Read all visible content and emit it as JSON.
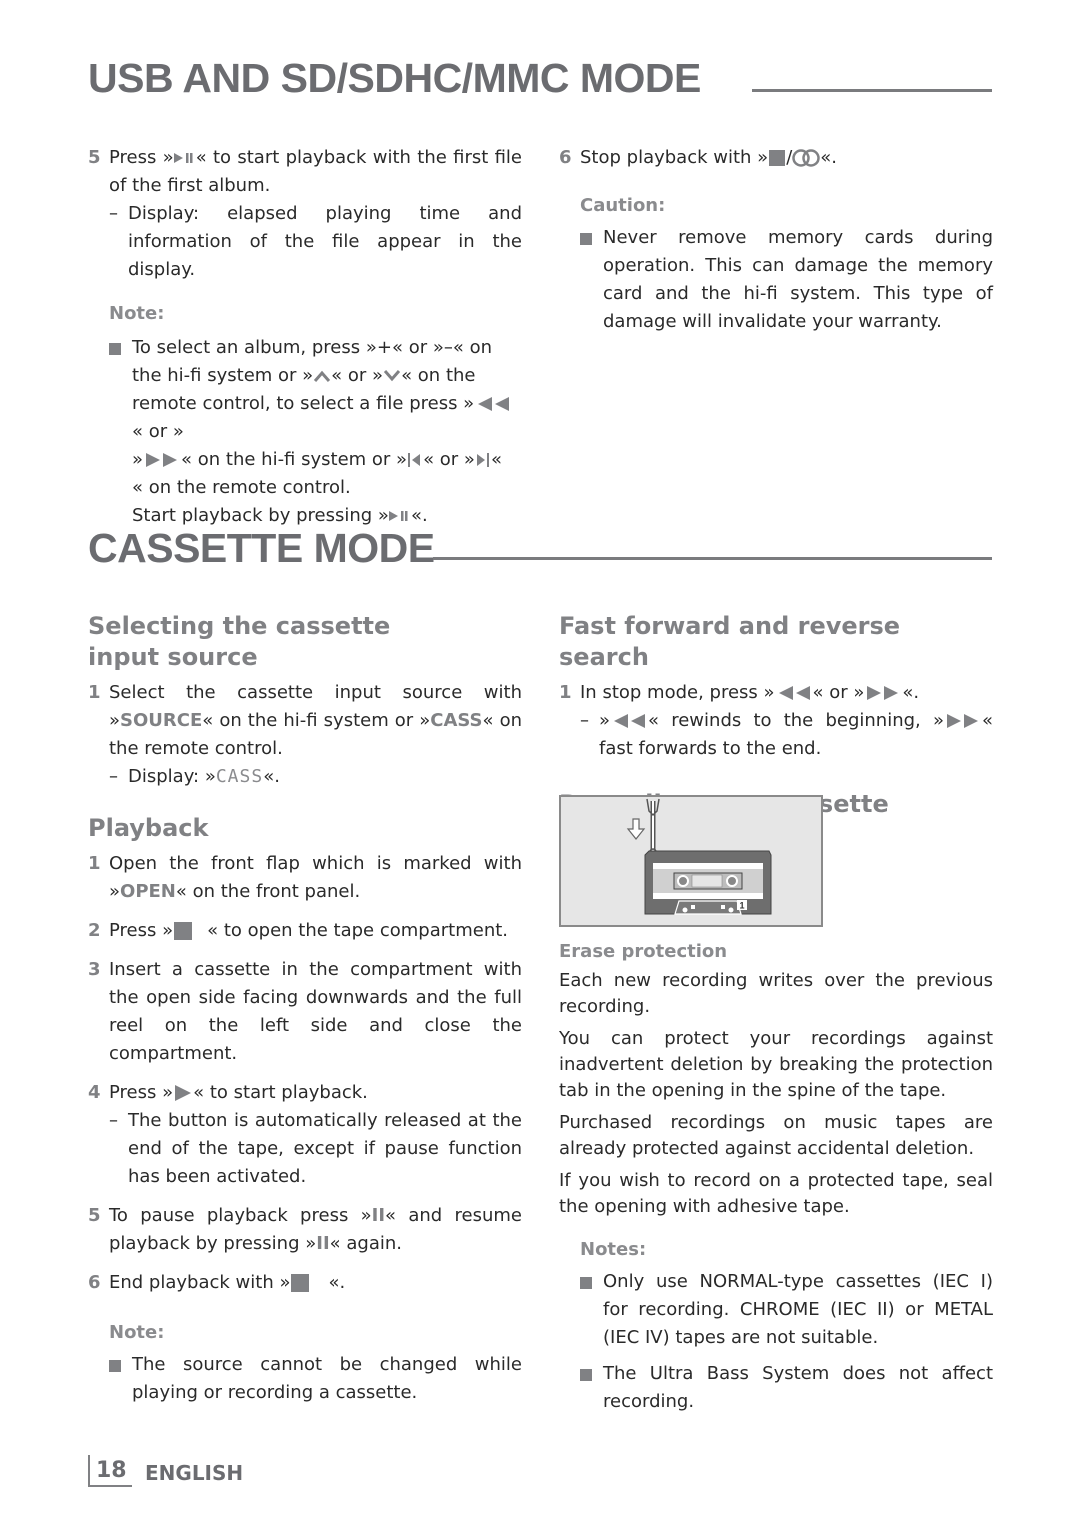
{
  "sections": {
    "usb": {
      "title": "USB AND SD/SDHC/MMC MODE",
      "step5": {
        "num": "5",
        "pre": "Press »",
        "post": "« to start playback with the first file of the first album.",
        "dash": "Display: elapsed playing time and information of the file appear in the display."
      },
      "note": {
        "heading": "Note:",
        "p1": "To select an album, press »+« or »–« on the hi-fi system or »",
        "p2": "« or »",
        "p3": "« on the remote control, to select a file press »",
        "p4": "« or »",
        "p5": "« on the hi-fi system or »",
        "p6": "« or »",
        "p7": "« on the remote control.",
        "start_pre": "Start playback by pressing »",
        "start_post": "«."
      },
      "step6": {
        "num": "6",
        "pre": "Stop playback with »",
        "mid": "/",
        "post": "«."
      },
      "caution": {
        "heading": "Caution:",
        "text": "Never remove memory cards during operation. This can damage the memory card and the hi-fi system. This type of damage will invalidate your warranty."
      }
    },
    "cassette": {
      "title": "CASSETTE MODE",
      "selecting": {
        "heading": "Selecting the cassette input source",
        "num": "1",
        "pre": "Select the cassette input source with »",
        "source": "SOURCE",
        "mid": "« on the hi-fi system or »",
        "cass": "CASS",
        "post": "« on the remote control.",
        "dash_pre": "Display: »",
        "display": "CASS",
        "dash_post": "«."
      },
      "playback": {
        "heading": "Playback",
        "s1_num": "1",
        "s1_pre": "Open the front flap which is marked with »",
        "s1_bold": "OPEN",
        "s1_post": "« on the front panel.",
        "s2_num": "2",
        "s2_pre": "Press »",
        "s2_post": "« to open the tape compartment.",
        "s3_num": "3",
        "s3": "Insert a cassette in the compartment with the open side facing downwards and the full reel on the left side and close the compartment.",
        "s4_num": "4",
        "s4_pre": "Press »",
        "s4_post": "« to start playback.",
        "s4_dash": "The button is automatically released at the end of the tape, except if pause function has been activated.",
        "s5_num": "5",
        "s5_pre": "To pause playback press »",
        "s5_pause": "II",
        "s5_mid": "« and resume playback by pressing »",
        "s5_post": "« again.",
        "s6_num": "6",
        "s6_pre": "End playback with »",
        "s6_post": "«."
      },
      "playback_note": {
        "heading": "Note:",
        "text": "The source cannot be changed while playing or recording a cassette."
      },
      "fast": {
        "heading": "Fast forward and reverse search",
        "num": "1",
        "pre": "In stop mode, press »",
        "mid": "« or »",
        "post": "«.",
        "dash_mid": "« rewinds to the beginning, »",
        "dash_post": "« fast forwards to the end."
      },
      "recording": {
        "heading": "Recording onto cassette",
        "figure_label": "1",
        "erase_heading": "Erase protection",
        "paragraphs": [
          "Each new recording writes over the previous recording.",
          "You can protect your recordings against inadvertent deletion by breaking the protection tab in the opening in the spine of the tape.",
          "Purchased recordings on music tapes are already protected against accidental deletion.",
          "If you wish to record on a protected tape, seal the opening with adhesive tape."
        ],
        "notes_heading": "Notes:",
        "notes": [
          "Only use NORMAL-type cassettes (IEC I) for recording. CHROME (IEC II) or METAL (IEC IV) tapes are not suitable.",
          "The Ultra Bass System does not affect recording."
        ]
      }
    }
  },
  "footer": {
    "page": "18",
    "language": "ENGLISH"
  },
  "colors": {
    "heading": "#6b6c70",
    "accent": "#808184",
    "text": "#2a2a2a"
  }
}
